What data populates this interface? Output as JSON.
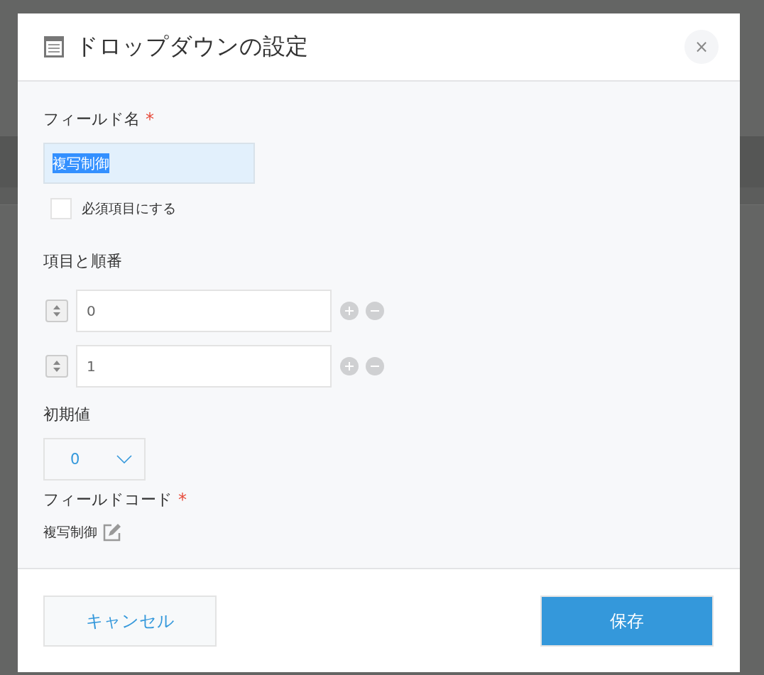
{
  "dialog": {
    "title": "ドロップダウンの設定",
    "close": "×"
  },
  "field_name": {
    "label": "フィールド名",
    "required_mark": "*",
    "value": "複写制御",
    "text_selected": true
  },
  "required_checkbox": {
    "label": "必須項目にする",
    "checked": false
  },
  "options": {
    "label": "項目と順番",
    "items": [
      {
        "value": "0"
      },
      {
        "value": "1"
      }
    ]
  },
  "default_value": {
    "label": "初期値",
    "value": "0"
  },
  "field_code": {
    "label": "フィールドコード",
    "required_mark": "*",
    "value": "複写制御"
  },
  "buttons": [
    {
      "label": "キャンセル",
      "kind": "secondary"
    },
    {
      "label": "保存",
      "kind": "primary"
    }
  ]
}
